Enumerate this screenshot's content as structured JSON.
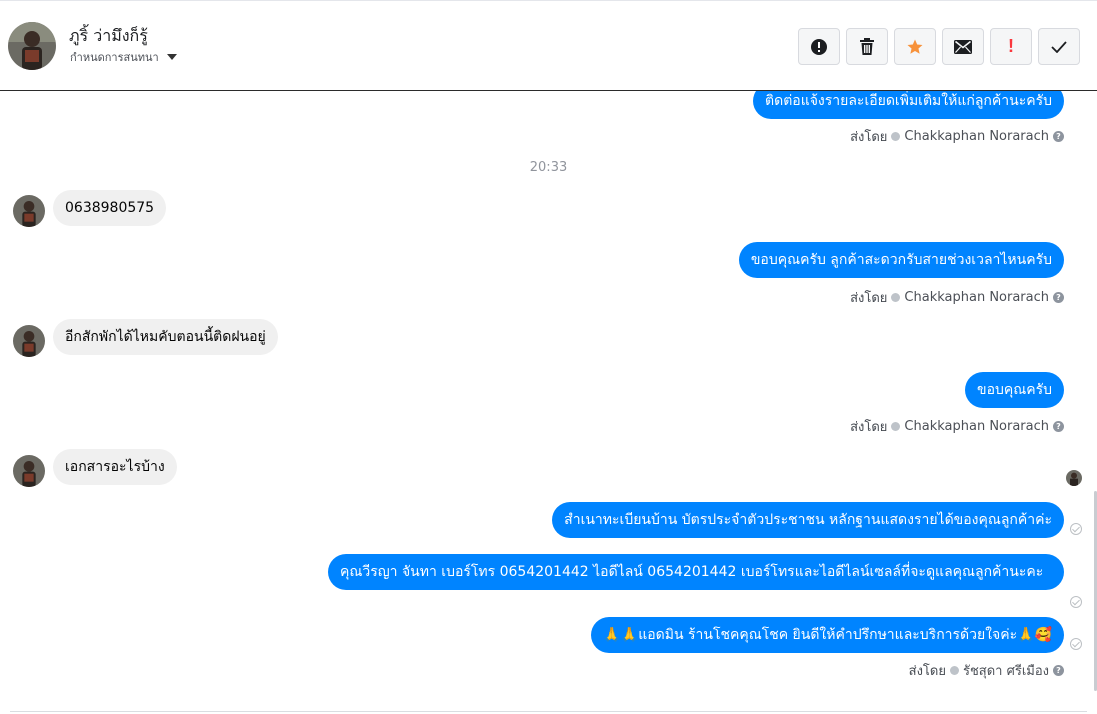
{
  "header": {
    "contact_name": "ภูริ้ ว่ามึงก็รู้",
    "assign_label": "กำหนดการสนทนา",
    "toolbar": [
      {
        "name": "report-icon",
        "label": ""
      },
      {
        "name": "trash-icon",
        "label": ""
      },
      {
        "name": "star-icon",
        "label": ""
      },
      {
        "name": "envelope-icon",
        "label": ""
      },
      {
        "name": "exclamation-icon",
        "label": "!"
      },
      {
        "name": "checkmark-icon",
        "label": ""
      }
    ]
  },
  "thread": {
    "messages": [
      {
        "dir": "out",
        "text": "ติดต่อแจ้งรายละเอียดเพิ่มเติมให้แก่ลูกค้านะครับ"
      },
      {
        "dir": "out",
        "text": "ขอบคุณครับ ลูกค้าสะดวกรับสายช่วงเวลาไหนครับ"
      },
      {
        "dir": "out",
        "text": "ขอบคุณครับ"
      },
      {
        "dir": "out",
        "text": "สำเนาทะเบียนบ้าน บัตรประจำตัวประชาชน หลักฐานแสดงรายได้ของคุณลูกค้าค่ะ"
      },
      {
        "dir": "out",
        "text": "คุณวีรญา จันทา      เบอร์โทร 0654201442  ไอดีไลน์ 0654201442   เบอร์โทรและไอดีไลน์เซลล์ที่จะดูแลคุณลูกค้านะคะ"
      },
      {
        "dir": "out",
        "text": "🙏🙏แอดมิน ร้านโชคคุณโชค ยินดีให้คำปรึกษาและบริการด้วยใจค่ะ🙏🥰"
      }
    ],
    "incoming": [
      {
        "text": "0638980575"
      },
      {
        "text": "อีกสักพักได้ไหมคับตอนนี้ติดฝนอยู่"
      },
      {
        "text": "เอกสารอะไรบ้าง"
      }
    ],
    "sent_by_prefix": "ส่งโดย",
    "agent_a": "Chakkaphan Norarach",
    "agent_b": "รัชสุดา ศรีเมือง",
    "help_glyph": "?",
    "timestamp": "20:33"
  },
  "colors": {
    "outgoing_bubble": "#0084ff",
    "incoming_bubble": "#f0f0f0",
    "star": "#f7923b",
    "alert": "#fa383e"
  }
}
